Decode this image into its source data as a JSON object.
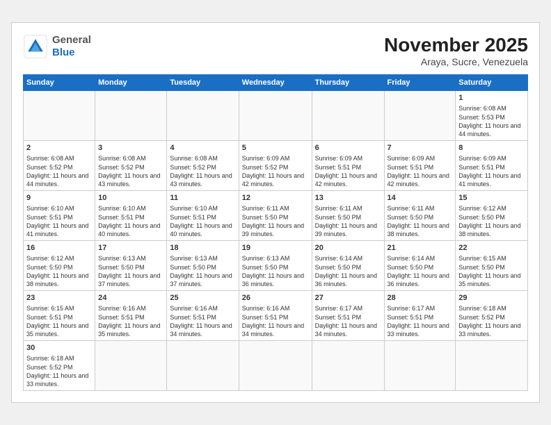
{
  "header": {
    "logo_general": "General",
    "logo_blue": "Blue",
    "month": "November 2025",
    "location": "Araya, Sucre, Venezuela"
  },
  "weekdays": [
    "Sunday",
    "Monday",
    "Tuesday",
    "Wednesday",
    "Thursday",
    "Friday",
    "Saturday"
  ],
  "weeks": [
    [
      {
        "day": "",
        "info": ""
      },
      {
        "day": "",
        "info": ""
      },
      {
        "day": "",
        "info": ""
      },
      {
        "day": "",
        "info": ""
      },
      {
        "day": "",
        "info": ""
      },
      {
        "day": "",
        "info": ""
      },
      {
        "day": "1",
        "info": "Sunrise: 6:08 AM\nSunset: 5:53 PM\nDaylight: 11 hours and 44 minutes."
      }
    ],
    [
      {
        "day": "2",
        "info": "Sunrise: 6:08 AM\nSunset: 5:52 PM\nDaylight: 11 hours and 44 minutes."
      },
      {
        "day": "3",
        "info": "Sunrise: 6:08 AM\nSunset: 5:52 PM\nDaylight: 11 hours and 43 minutes."
      },
      {
        "day": "4",
        "info": "Sunrise: 6:08 AM\nSunset: 5:52 PM\nDaylight: 11 hours and 43 minutes."
      },
      {
        "day": "5",
        "info": "Sunrise: 6:09 AM\nSunset: 5:52 PM\nDaylight: 11 hours and 42 minutes."
      },
      {
        "day": "6",
        "info": "Sunrise: 6:09 AM\nSunset: 5:51 PM\nDaylight: 11 hours and 42 minutes."
      },
      {
        "day": "7",
        "info": "Sunrise: 6:09 AM\nSunset: 5:51 PM\nDaylight: 11 hours and 42 minutes."
      },
      {
        "day": "8",
        "info": "Sunrise: 6:09 AM\nSunset: 5:51 PM\nDaylight: 11 hours and 41 minutes."
      }
    ],
    [
      {
        "day": "9",
        "info": "Sunrise: 6:10 AM\nSunset: 5:51 PM\nDaylight: 11 hours and 41 minutes."
      },
      {
        "day": "10",
        "info": "Sunrise: 6:10 AM\nSunset: 5:51 PM\nDaylight: 11 hours and 40 minutes."
      },
      {
        "day": "11",
        "info": "Sunrise: 6:10 AM\nSunset: 5:51 PM\nDaylight: 11 hours and 40 minutes."
      },
      {
        "day": "12",
        "info": "Sunrise: 6:11 AM\nSunset: 5:50 PM\nDaylight: 11 hours and 39 minutes."
      },
      {
        "day": "13",
        "info": "Sunrise: 6:11 AM\nSunset: 5:50 PM\nDaylight: 11 hours and 39 minutes."
      },
      {
        "day": "14",
        "info": "Sunrise: 6:11 AM\nSunset: 5:50 PM\nDaylight: 11 hours and 38 minutes."
      },
      {
        "day": "15",
        "info": "Sunrise: 6:12 AM\nSunset: 5:50 PM\nDaylight: 11 hours and 38 minutes."
      }
    ],
    [
      {
        "day": "16",
        "info": "Sunrise: 6:12 AM\nSunset: 5:50 PM\nDaylight: 11 hours and 38 minutes."
      },
      {
        "day": "17",
        "info": "Sunrise: 6:13 AM\nSunset: 5:50 PM\nDaylight: 11 hours and 37 minutes."
      },
      {
        "day": "18",
        "info": "Sunrise: 6:13 AM\nSunset: 5:50 PM\nDaylight: 11 hours and 37 minutes."
      },
      {
        "day": "19",
        "info": "Sunrise: 6:13 AM\nSunset: 5:50 PM\nDaylight: 11 hours and 36 minutes."
      },
      {
        "day": "20",
        "info": "Sunrise: 6:14 AM\nSunset: 5:50 PM\nDaylight: 11 hours and 36 minutes."
      },
      {
        "day": "21",
        "info": "Sunrise: 6:14 AM\nSunset: 5:50 PM\nDaylight: 11 hours and 36 minutes."
      },
      {
        "day": "22",
        "info": "Sunrise: 6:15 AM\nSunset: 5:50 PM\nDaylight: 11 hours and 35 minutes."
      }
    ],
    [
      {
        "day": "23",
        "info": "Sunrise: 6:15 AM\nSunset: 5:51 PM\nDaylight: 11 hours and 35 minutes."
      },
      {
        "day": "24",
        "info": "Sunrise: 6:16 AM\nSunset: 5:51 PM\nDaylight: 11 hours and 35 minutes."
      },
      {
        "day": "25",
        "info": "Sunrise: 6:16 AM\nSunset: 5:51 PM\nDaylight: 11 hours and 34 minutes."
      },
      {
        "day": "26",
        "info": "Sunrise: 6:16 AM\nSunset: 5:51 PM\nDaylight: 11 hours and 34 minutes."
      },
      {
        "day": "27",
        "info": "Sunrise: 6:17 AM\nSunset: 5:51 PM\nDaylight: 11 hours and 34 minutes."
      },
      {
        "day": "28",
        "info": "Sunrise: 6:17 AM\nSunset: 5:51 PM\nDaylight: 11 hours and 33 minutes."
      },
      {
        "day": "29",
        "info": "Sunrise: 6:18 AM\nSunset: 5:52 PM\nDaylight: 11 hours and 33 minutes."
      }
    ],
    [
      {
        "day": "30",
        "info": "Sunrise: 6:18 AM\nSunset: 5:52 PM\nDaylight: 11 hours and 33 minutes."
      },
      {
        "day": "",
        "info": ""
      },
      {
        "day": "",
        "info": ""
      },
      {
        "day": "",
        "info": ""
      },
      {
        "day": "",
        "info": ""
      },
      {
        "day": "",
        "info": ""
      },
      {
        "day": "",
        "info": ""
      }
    ]
  ]
}
